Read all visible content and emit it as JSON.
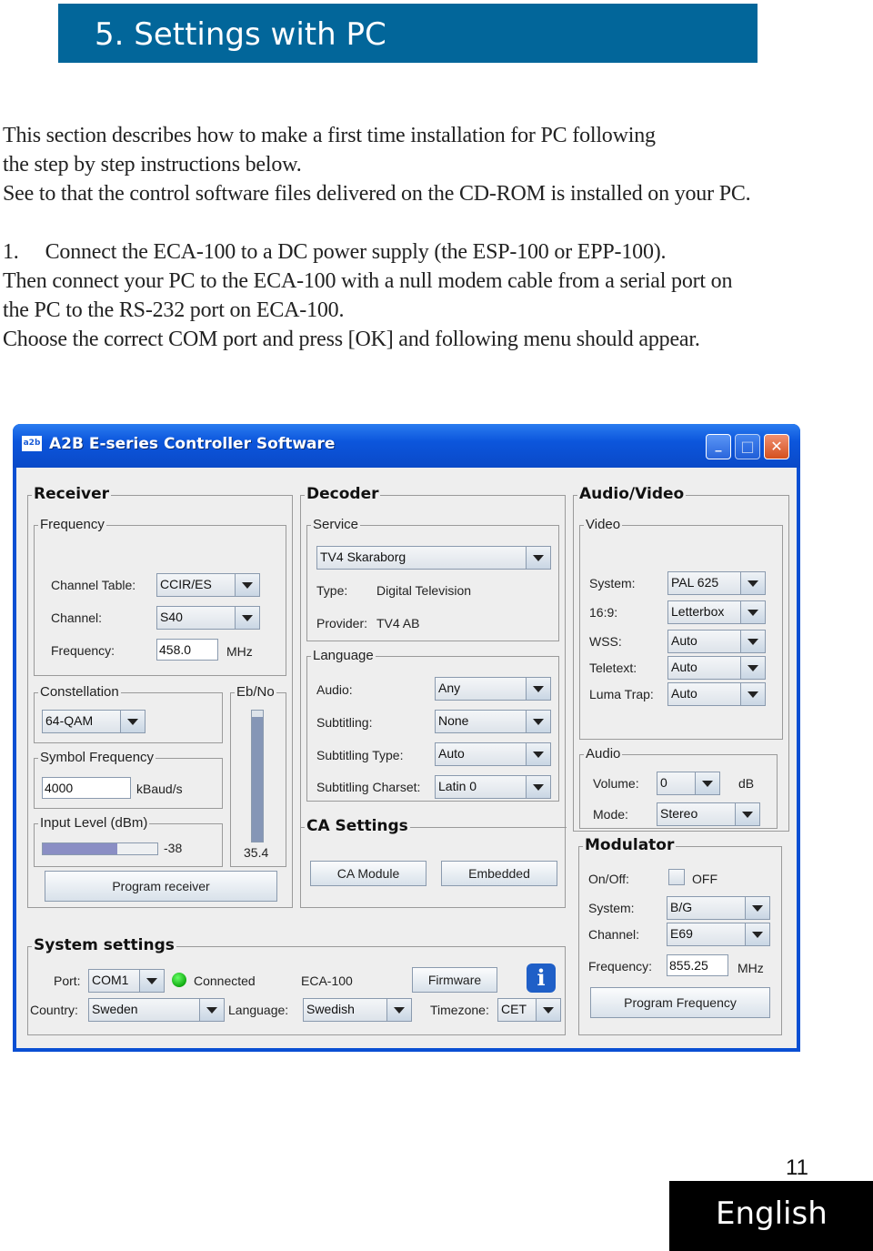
{
  "banner": {
    "title": "5. Settings with PC",
    "color": "#02669a"
  },
  "body_text": [
    "This section describes how to make a first time installation for PC following",
    "the step by step instructions below.",
    "See to that the control software files delivered on the CD-ROM is installed on your PC.",
    "1.     Connect the ECA-100 to a DC power supply (the ESP-100 or EPP-100).",
    "Then connect your PC to the ECA-100 with a null modem cable from a serial port on",
    "the PC to the RS-232 port on ECA-100.",
    "Choose the correct COM port and press [OK] and following menu should appear."
  ],
  "window": {
    "app_icon": "a2b",
    "title": "A2B E-series Controller Software",
    "controls": {
      "minimize": "_",
      "maximize": "□",
      "close": "✕"
    },
    "receiver": {
      "title": "Receiver",
      "frequency_group": "Frequency",
      "channel_table_label": "Channel Table:",
      "channel_table": "CCIR/ES",
      "channel_label": "Channel:",
      "channel": "S40",
      "frequency_label": "Frequency:",
      "frequency": "458.0",
      "frequency_unit": "MHz",
      "constellation_group": "Constellation",
      "constellation": "64-QAM",
      "ebno_group": "Eb/No",
      "ebno_value": "35.4",
      "ebno_fill": 0.95,
      "symbol_group": "Symbol Frequency",
      "symbol_frequency": "4000",
      "symbol_unit": "kBaud/s",
      "input_group": "Input Level (dBm)",
      "input_level": "-38",
      "input_fill": 0.65,
      "program_button": "Program receiver"
    },
    "decoder": {
      "title": "Decoder",
      "service_group": "Service",
      "service": "TV4 Skaraborg",
      "type_label": "Type:",
      "type_value": "Digital Television",
      "provider_label": "Provider:",
      "provider_value": "TV4 AB",
      "language_group": "Language",
      "audio_label": "Audio:",
      "audio": "Any",
      "subtitling_label": "Subtitling:",
      "subtitling": "None",
      "subtitling_type_label": "Subtitling Type:",
      "subtitling_type": "Auto",
      "subtitling_charset_label": "Subtitling Charset:",
      "subtitling_charset": "Latin 0",
      "ca_title": "CA Settings",
      "ca_module_button": "CA Module",
      "embedded_button": "Embedded"
    },
    "audio_video": {
      "title": "Audio/Video",
      "video_group": "Video",
      "system_label": "System:",
      "system": "PAL 625",
      "aspect_label": "16:9:",
      "aspect": "Letterbox",
      "wss_label": "WSS:",
      "wss": "Auto",
      "teletext_label": "Teletext:",
      "teletext": "Auto",
      "luma_label": "Luma Trap:",
      "luma": "Auto",
      "audio_group": "Audio",
      "volume_label": "Volume:",
      "volume": "0",
      "volume_unit": "dB",
      "mode_label": "Mode:",
      "mode": "Stereo"
    },
    "modulator": {
      "title": "Modulator",
      "onoff_label": "On/Off:",
      "onoff_state": "OFF",
      "system_label": "System:",
      "system": "B/G",
      "channel_label": "Channel:",
      "channel": "E69",
      "frequency_label": "Frequency:",
      "frequency": "855.25",
      "frequency_unit": "MHz",
      "program_button": "Program Frequency"
    },
    "system": {
      "title": "System settings",
      "port_label": "Port:",
      "port": "COM1",
      "status": "Connected",
      "status_color": "#22bb22",
      "device": "ECA-100",
      "firmware_button": "Firmware",
      "country_label": "Country:",
      "country": "Sweden",
      "language_label": "Language:",
      "language": "Swedish",
      "timezone_label": "Timezone:",
      "timezone": "CET"
    }
  },
  "footer": {
    "page_number": "11",
    "language": "English"
  }
}
